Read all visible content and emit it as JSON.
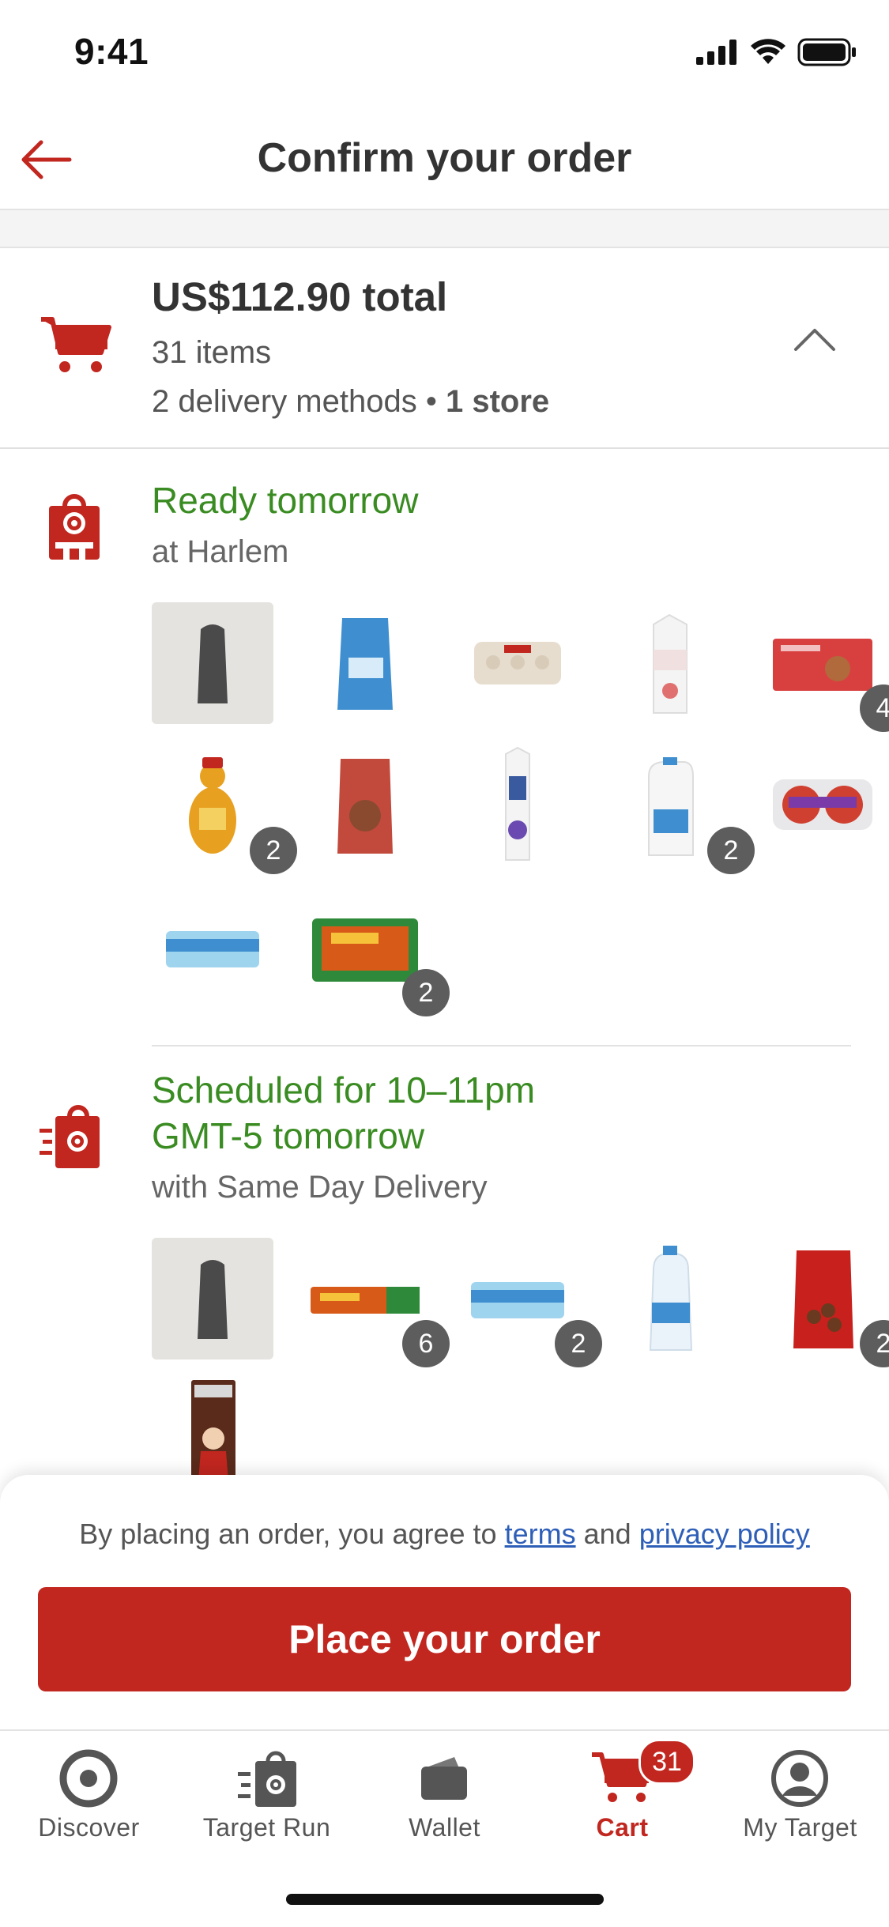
{
  "status_bar": {
    "time": "9:41"
  },
  "header": {
    "title": "Confirm your order"
  },
  "summary": {
    "total": "US$112.90 total",
    "items": "31 items",
    "methods": "2 delivery methods",
    "separator": "•",
    "stores": "1 store"
  },
  "pickup": {
    "title": "Ready tomorrow",
    "subtitle": "at Harlem",
    "products": [
      {
        "icon": "vase-product",
        "qty": ""
      },
      {
        "icon": "sugar-bag-product",
        "qty": ""
      },
      {
        "icon": "egg-carton-product",
        "qty": ""
      },
      {
        "icon": "whipping-cream-product",
        "qty": ""
      },
      {
        "icon": "cookie-pack-product",
        "qty": "4"
      },
      {
        "icon": "honey-bear-product",
        "qty": "2"
      },
      {
        "icon": "coffee-bag-product",
        "qty": ""
      },
      {
        "icon": "half-and-half-product",
        "qty": ""
      },
      {
        "icon": "milk-gallon-product",
        "qty": "2"
      },
      {
        "icon": "apples-product",
        "qty": ""
      },
      {
        "icon": "water-case-product",
        "qty": ""
      },
      {
        "icon": "reeses-pack-product",
        "qty": "2"
      }
    ]
  },
  "delivery": {
    "title_line1": "Scheduled for 10–11pm",
    "title_line2": "GMT-5 tomorrow",
    "subtitle": "with Same Day Delivery",
    "products": [
      {
        "icon": "vase-product",
        "qty": ""
      },
      {
        "icon": "reeses-bar-product",
        "qty": "6"
      },
      {
        "icon": "water-case-product",
        "qty": "2"
      },
      {
        "icon": "water-jug-product",
        "qty": ""
      },
      {
        "icon": "candy-bag-product",
        "qty": "2"
      },
      {
        "icon": "hersheys-santa-product",
        "qty": ""
      }
    ]
  },
  "footer": {
    "agree_prefix": "By placing an order, you agree to",
    "terms": "terms",
    "and": "and",
    "privacy": "privacy policy",
    "place_order": "Place your order"
  },
  "tabs": [
    {
      "label": "Discover",
      "icon": "target-logo-icon"
    },
    {
      "label": "Target Run",
      "icon": "fast-bag-icon"
    },
    {
      "label": "Wallet",
      "icon": "wallet-icon"
    },
    {
      "label": "Cart",
      "icon": "cart-icon",
      "active": true
    },
    {
      "label": "My Target",
      "icon": "profile-icon"
    }
  ],
  "cart_count": "31",
  "colors": {
    "brand_red": "#c1261f",
    "green": "#3a8c22",
    "link_blue": "#2e5fb8",
    "badge_gray": "#5d5d5d"
  }
}
